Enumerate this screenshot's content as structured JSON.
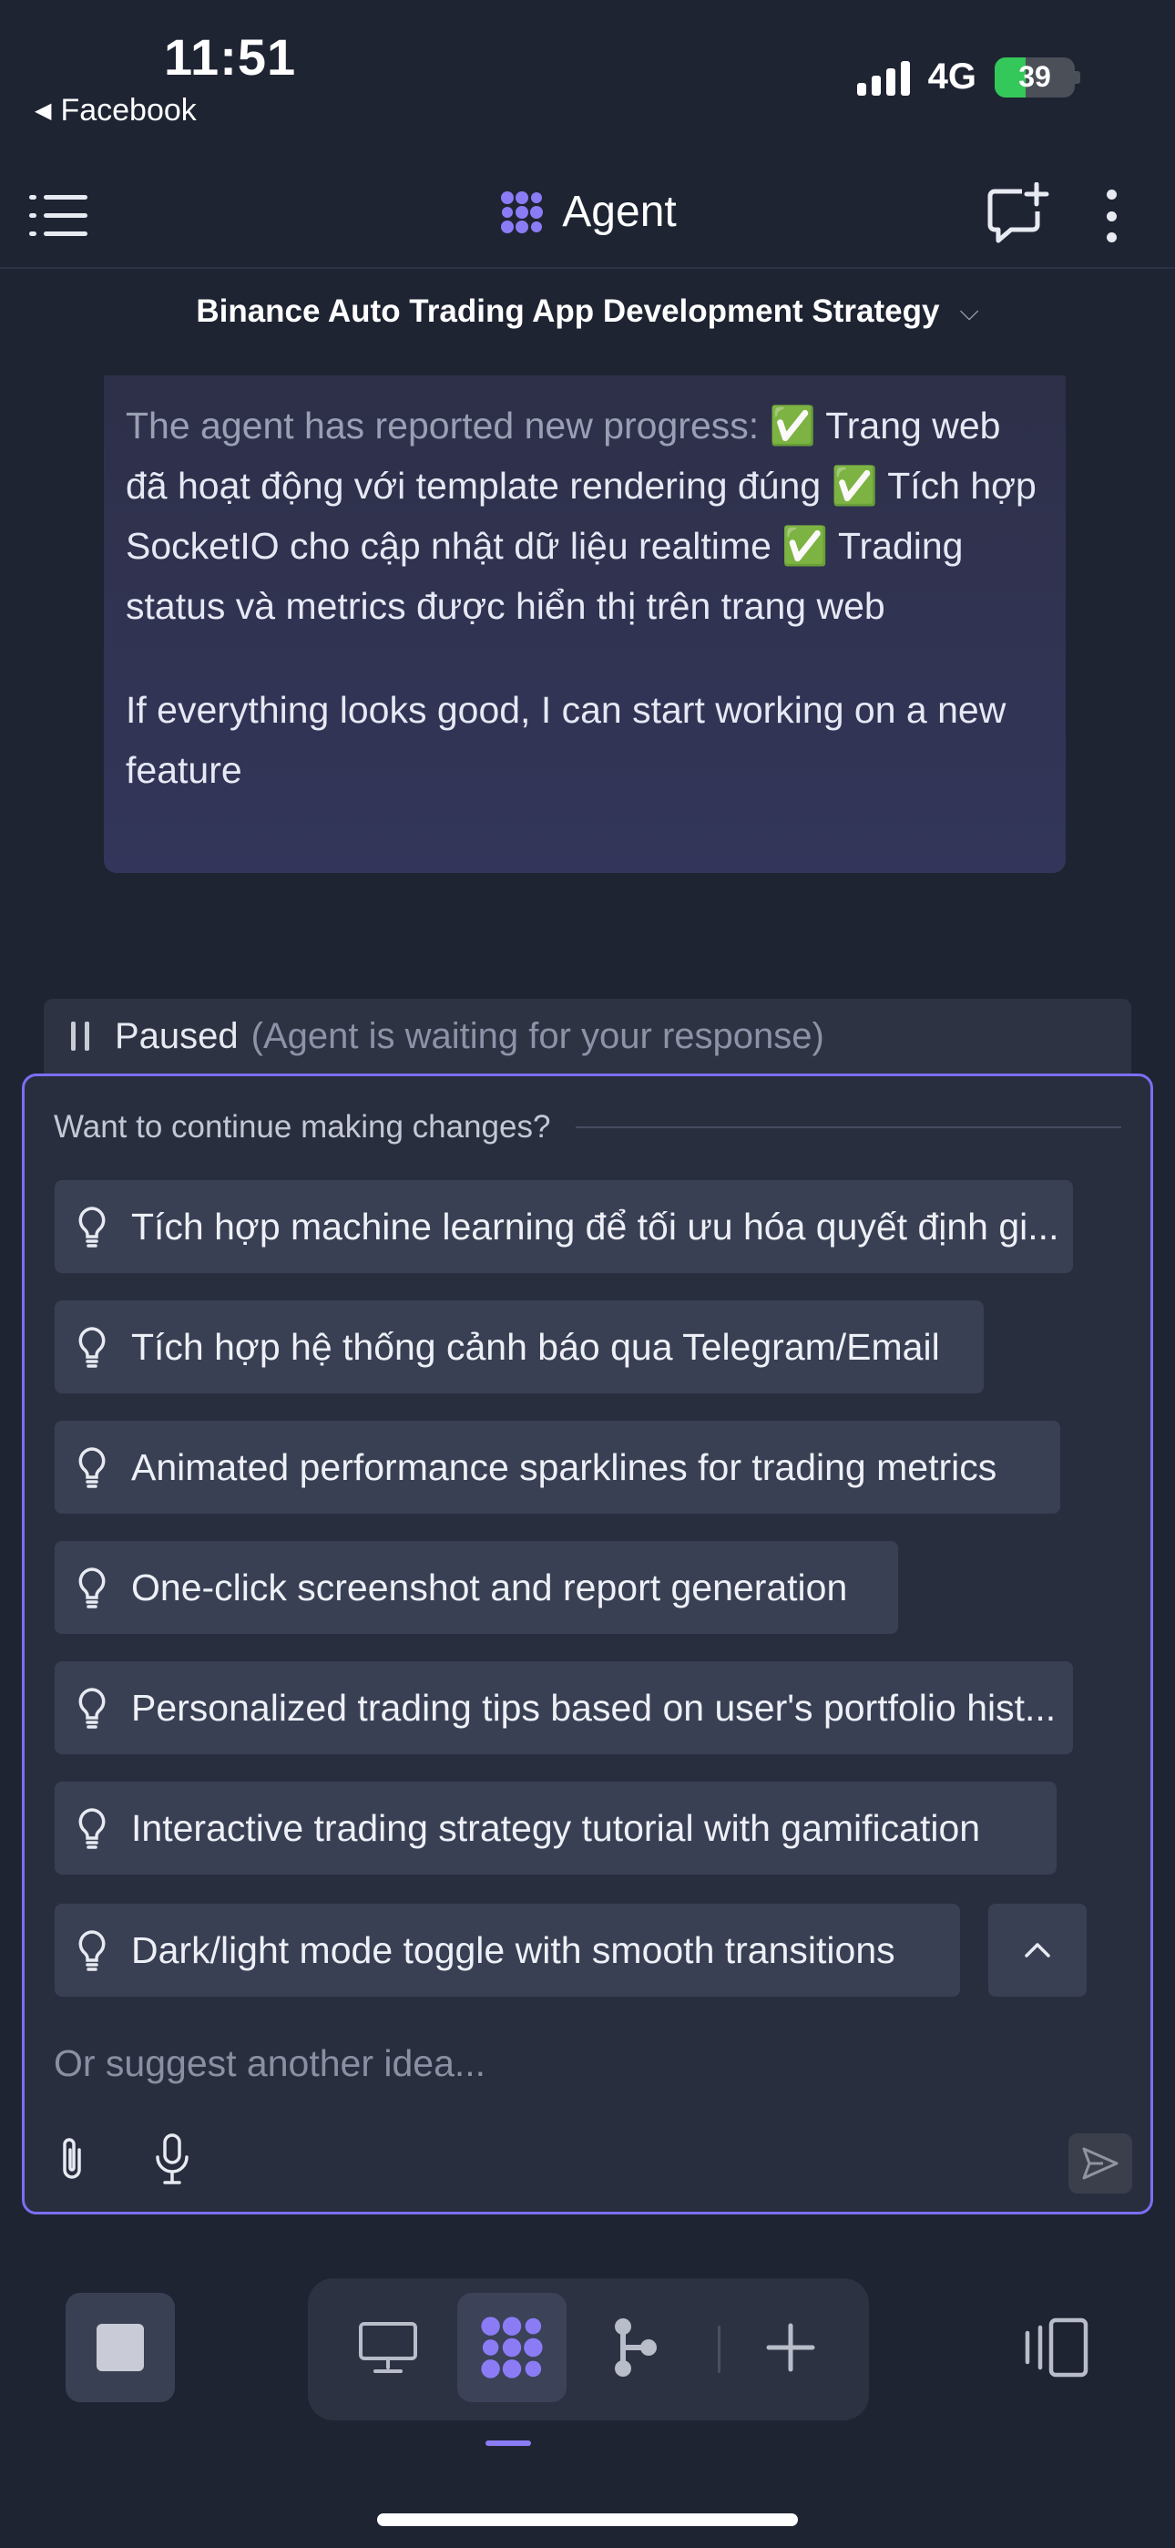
{
  "status_bar": {
    "time": "11:51",
    "back_app": "Facebook",
    "network": "4G",
    "battery": "39",
    "battery_level": 0.39
  },
  "header": {
    "menu_icon": "hamburger-menu-icon",
    "title": "Agent",
    "logo_icon": "agent-logo-icon",
    "new_chat_icon": "new-chat-icon",
    "more_icon": "more-vertical-icon",
    "project_title": "Binance Auto Trading App Development Strategy"
  },
  "message": {
    "lead": "The agent has reported new progress:",
    "body": " ✅ Trang web đã hoạt động với template rendering đúng ✅ Tích hợp SocketIO cho cập nhật dữ liệu realtime ✅ Trading status và metrics được hiển thị trên trang web",
    "followup": "If everything looks good, I can start working on a new feature"
  },
  "paused": {
    "label": "Paused",
    "sub": "(Agent is waiting for your response)"
  },
  "suggestions": {
    "heading": "Want to continue making changes?",
    "items": [
      "Tích hợp machine learning để tối ưu hóa quyết định gi...",
      "Tích hợp hệ thống cảnh báo qua Telegram/Email",
      "Animated performance sparklines for trading metrics",
      "One-click screenshot and report generation",
      "Personalized trading tips based on user's portfolio hist...",
      "Interactive trading strategy tutorial with gamification",
      "Dark/light mode toggle with smooth transitions"
    ],
    "input_placeholder": "Or suggest another idea..."
  },
  "toolbar": {
    "stop_icon": "stop-icon",
    "tools": [
      "monitor-icon",
      "agent-logo-icon",
      "workflow-icon",
      "plus-icon"
    ],
    "active_tool": "agent-logo-icon",
    "panel_icon": "panel-toggle-icon"
  },
  "colors": {
    "background": "#1f2433",
    "accent": "#8b7cf6",
    "chip": "#3a4054",
    "battery_green": "#34c759"
  }
}
